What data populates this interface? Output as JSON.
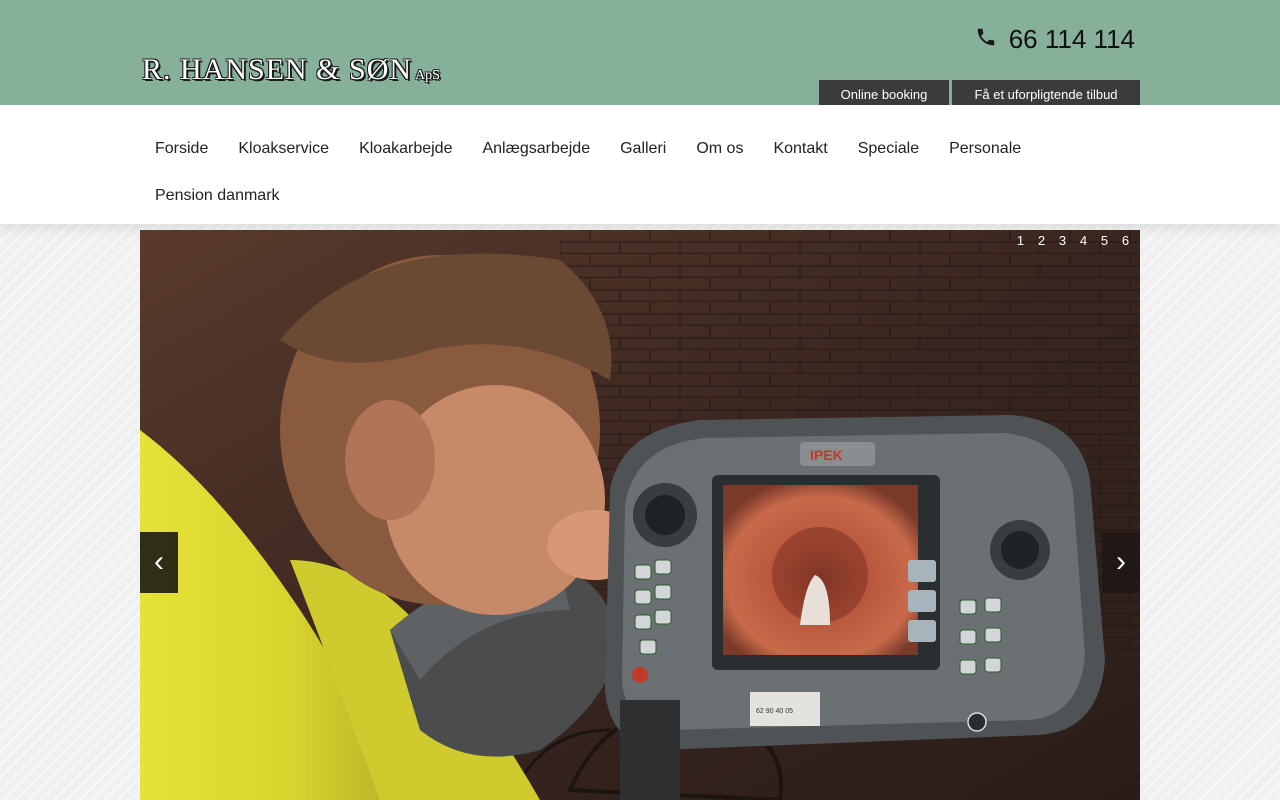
{
  "header": {
    "logo_text": "R. HANSEN & SØN",
    "logo_suffix": "ApS",
    "phone_number": "66 114 114",
    "phone_icon": "phone-icon",
    "online_booking_label": "Online booking",
    "quote_label": "Få et uforpligtende tilbud",
    "background_color": "#86b09a"
  },
  "nav": {
    "items": [
      {
        "label": "Forside"
      },
      {
        "label": "Kloakservice"
      },
      {
        "label": "Kloakarbejde"
      },
      {
        "label": "Anlægsarbejde"
      },
      {
        "label": "Galleri"
      },
      {
        "label": "Om os"
      },
      {
        "label": "Kontakt"
      },
      {
        "label": "Speciale"
      },
      {
        "label": "Personale"
      },
      {
        "label": "Pension danmark"
      }
    ]
  },
  "slider": {
    "pages": [
      "1",
      "2",
      "3",
      "4",
      "5",
      "6"
    ],
    "prev_label": "‹",
    "next_label": "›",
    "device_brand": "IPEK",
    "device_sticker": "62 90 40 05"
  }
}
